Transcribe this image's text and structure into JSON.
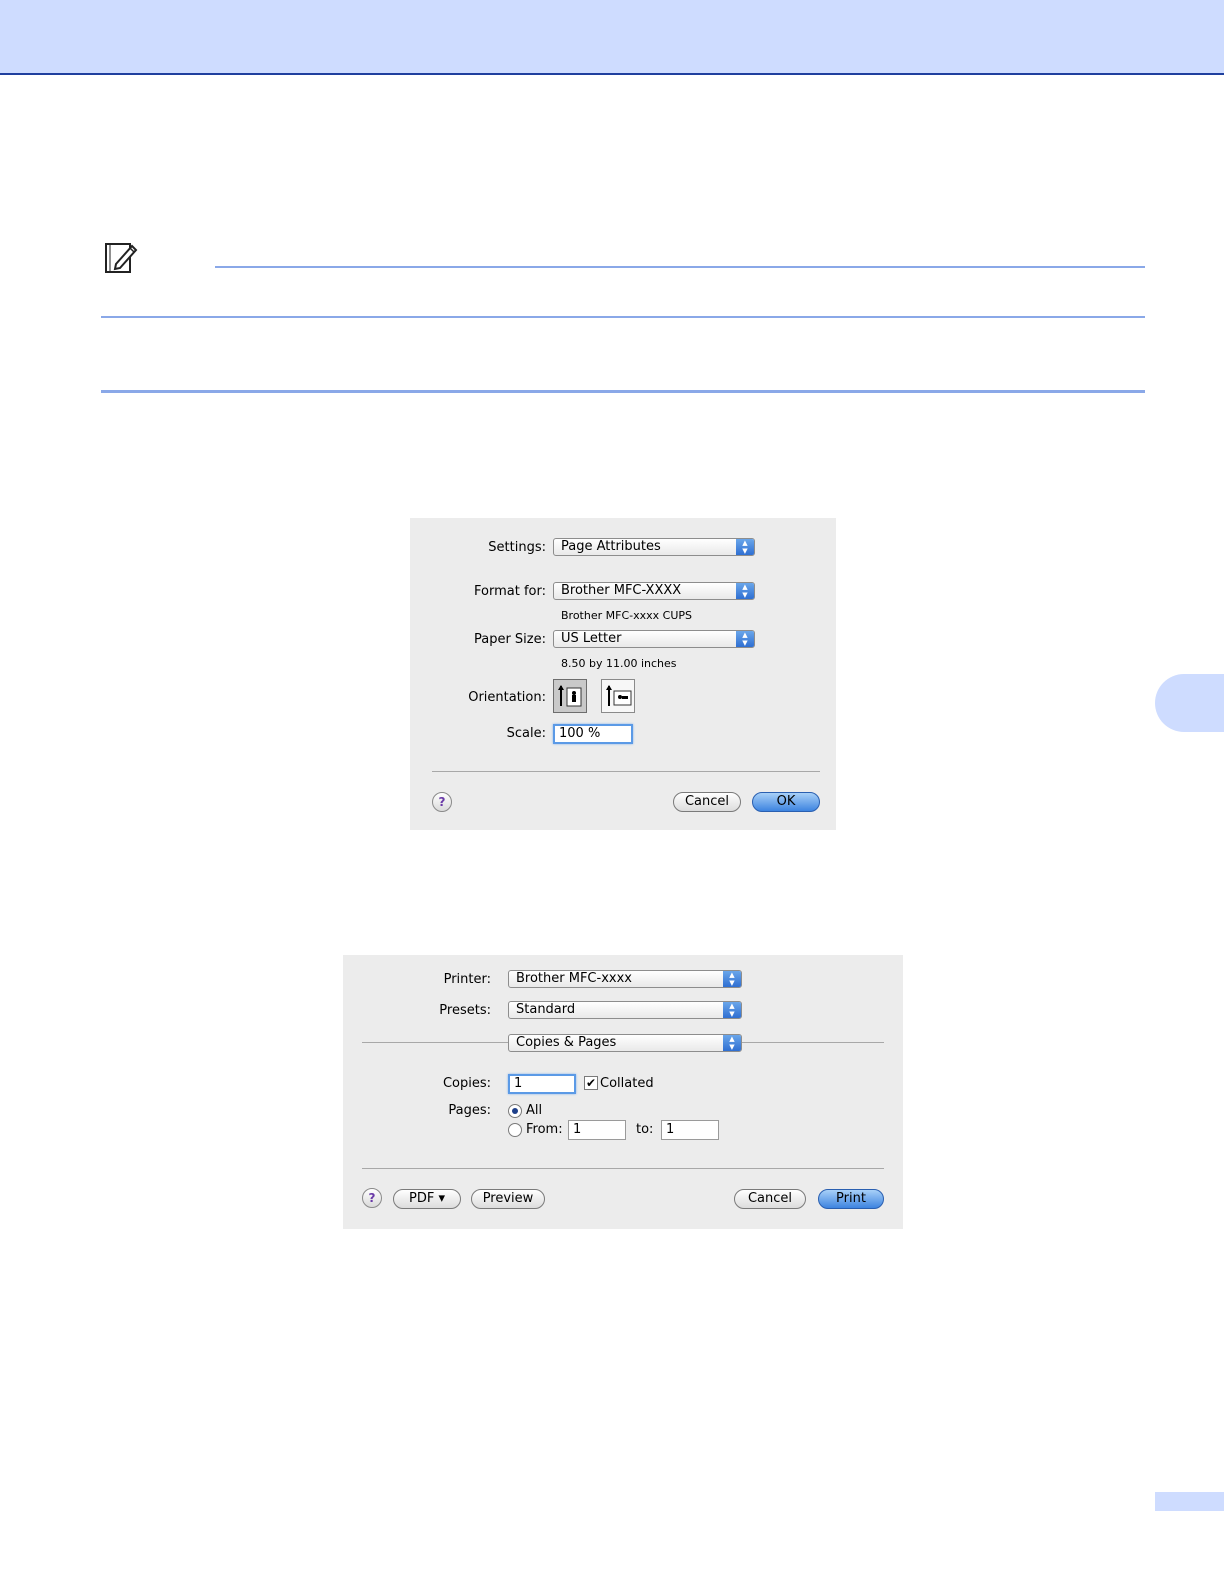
{
  "page_setup": {
    "settings_label": "Settings:",
    "settings_value": "Page Attributes",
    "format_for_label": "Format for:",
    "format_for_value": "Brother MFC-XXXX",
    "format_for_sub": "Brother MFC-xxxx CUPS",
    "paper_size_label": "Paper Size:",
    "paper_size_value": "US Letter",
    "paper_size_sub": "8.50 by 11.00 inches",
    "orientation_label": "Orientation:",
    "scale_label": "Scale:",
    "scale_value": "100 %",
    "help_glyph": "?",
    "cancel_label": "Cancel",
    "ok_label": "OK"
  },
  "print_dialog": {
    "printer_label": "Printer:",
    "printer_value": "Brother MFC-xxxx",
    "presets_label": "Presets:",
    "presets_value": "Standard",
    "panel_value": "Copies & Pages",
    "copies_label": "Copies:",
    "copies_value": "1",
    "collated_label": "Collated",
    "pages_label": "Pages:",
    "all_label": "All",
    "from_label": "From:",
    "from_value": "1",
    "to_label": "to:",
    "to_value": "1",
    "help_glyph": "?",
    "pdf_label": "PDF ▾",
    "preview_label": "Preview",
    "cancel_label": "Cancel",
    "print_label": "Print"
  },
  "colors": {
    "band": "#cedcff",
    "rule": "#8aa8e8",
    "dialog_bg": "#ececec",
    "default_button": "#3d84e0"
  },
  "icons": {
    "note": "note-pencil-icon",
    "popup_arrows": "updown-arrows-icon",
    "portrait": "portrait-orientation-icon",
    "landscape": "landscape-orientation-icon"
  }
}
